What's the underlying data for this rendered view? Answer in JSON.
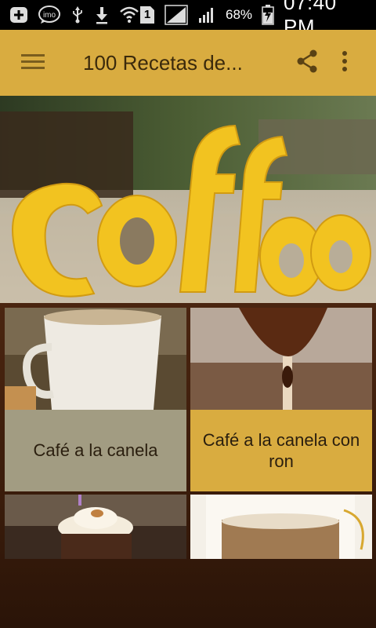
{
  "status_bar": {
    "sim_slot": "1",
    "battery_percent": "68%",
    "time": "07:40 PM",
    "icons": [
      "add-box-icon",
      "imo-icon",
      "usb-icon",
      "download-icon",
      "wifi-icon",
      "sim-1-icon",
      "signal-icon",
      "signal-icon",
      "battery-charging-icon"
    ]
  },
  "app_bar": {
    "title": "100 Recetas de...",
    "color": "#D9AC40",
    "icons": [
      "menu-icon",
      "share-icon",
      "more-vert-icon"
    ]
  },
  "hero": {
    "sign_text": "coffee"
  },
  "cards": [
    {
      "label": "Café a la canela",
      "caption_color": "#A29C82"
    },
    {
      "label": "Café a la canela con ron",
      "caption_color": "#D9AC40"
    },
    {
      "label": "",
      "caption_color": ""
    },
    {
      "label": "",
      "caption_color": ""
    }
  ]
}
